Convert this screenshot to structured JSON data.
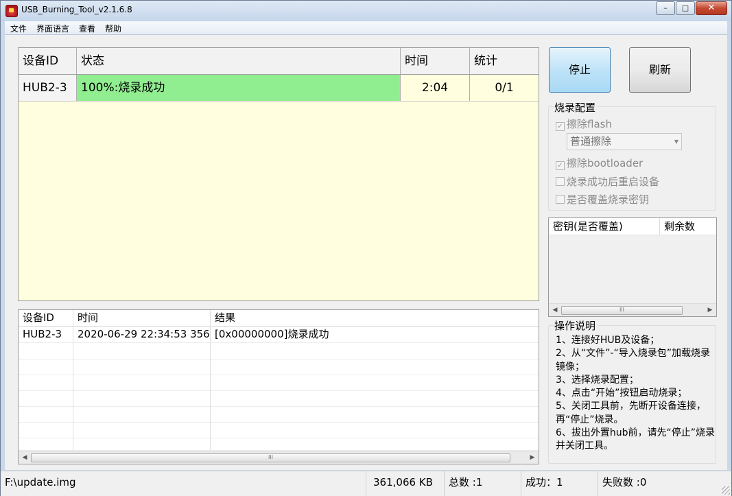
{
  "window": {
    "title": "USB_Burning_Tool_v2.1.6.8",
    "minimize": "–",
    "maximize": "□",
    "close": "✕"
  },
  "menu": [
    "文件",
    "界面语言",
    "查看",
    "帮助"
  ],
  "device_table": {
    "headers": [
      "设备ID",
      "状态",
      "时间",
      "统计"
    ],
    "rows": [
      {
        "id": "HUB2-3",
        "status": "100%:烧录成功",
        "time": "2:04",
        "stats": "0/1"
      }
    ]
  },
  "log_table": {
    "headers": [
      "设备ID",
      "时间",
      "结果"
    ],
    "rows": [
      {
        "id": "HUB2-3",
        "time": "2020-06-29 22:34:53 356",
        "result": "[0x00000000]烧录成功"
      }
    ],
    "scroll_grip": "III"
  },
  "buttons": {
    "stop": "停止",
    "refresh": "刷新"
  },
  "burn_config": {
    "title": "烧录配置",
    "erase_flash": {
      "label": "擦除flash",
      "checked": true
    },
    "erase_mode": "普通擦除",
    "erase_bootloader": {
      "label": "擦除bootloader",
      "checked": true
    },
    "reboot_after": {
      "label": "烧录成功后重启设备",
      "checked": false
    },
    "overwrite_key": {
      "label": "是否覆盖烧录密钥",
      "checked": false
    }
  },
  "key_table": {
    "headers": [
      "密钥(是否覆盖)",
      "剩余数"
    ],
    "scroll_grip": "III"
  },
  "help": {
    "title": "操作说明",
    "lines": [
      "1、连接好HUB及设备；",
      "2、从“文件”-“导入烧录包”加载烧录镜像；",
      "3、选择烧录配置；",
      "4、点击“开始”按钮启动烧录；",
      "5、关闭工具前，先断开设备连接，再“停止”烧录。",
      "6、拔出外置hub前，请先“停止”烧录并关闭工具。"
    ]
  },
  "status_bar": {
    "file": "F:\\update.img",
    "size": "361,066 KB",
    "total": "总数 :1",
    "success": "成功：1",
    "fail": "失败数 :0"
  },
  "colors": {
    "success_cell": "#90ee90",
    "device_area_bg": "#ffffe0",
    "stop_button": "#bfe3f8"
  }
}
